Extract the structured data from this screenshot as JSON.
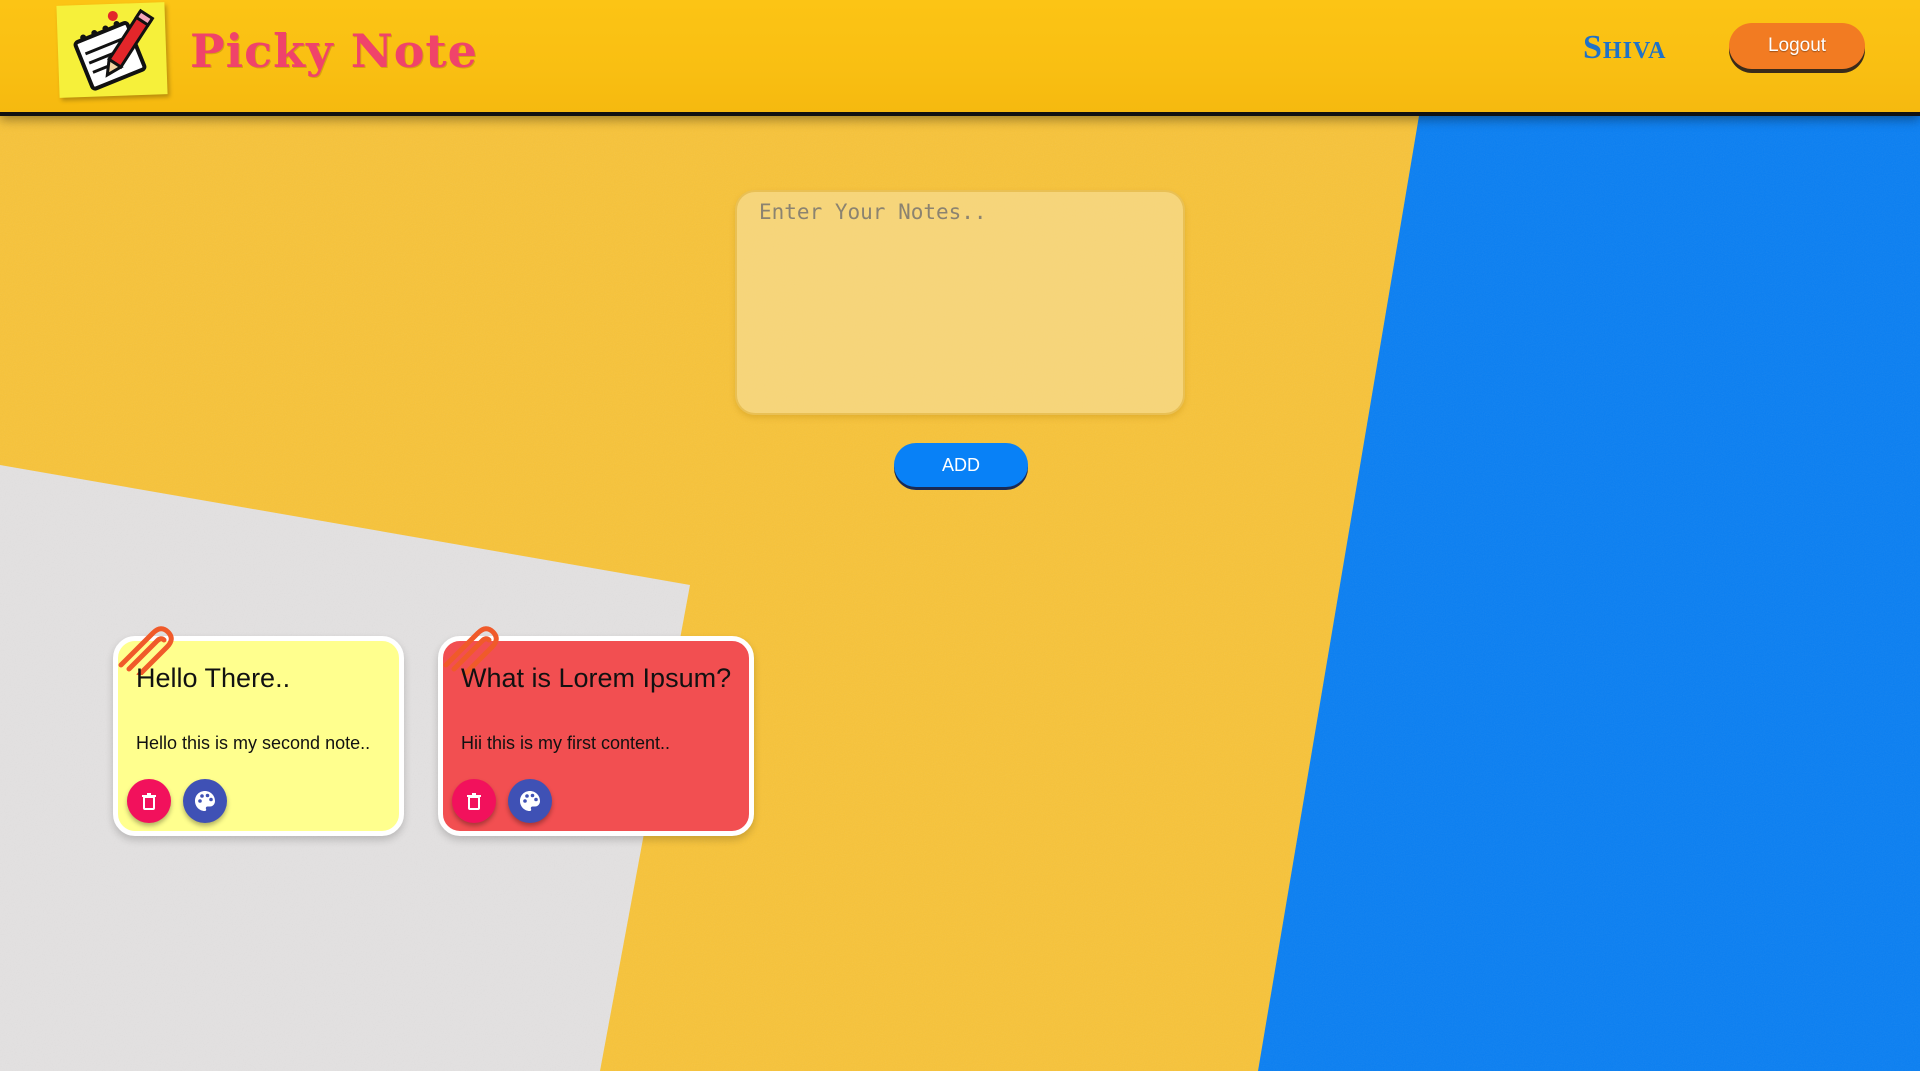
{
  "app": {
    "brand": "Picky Note",
    "username": "Shiva",
    "logout_label": "Logout"
  },
  "composer": {
    "placeholder": "Enter Your Notes..",
    "value": "",
    "add_label": "ADD"
  },
  "notes": [
    {
      "title": "Hello There..",
      "content": "Hello this is my second note..",
      "color": "#ffff8e",
      "actions": [
        "trash-icon",
        "palette-icon"
      ]
    },
    {
      "title": "What is Lorem Ipsum?",
      "content": "Hii this is my first content..",
      "color": "#f24f51",
      "actions": [
        "trash-icon",
        "palette-icon"
      ]
    }
  ],
  "theme": {
    "header": "#fcc415",
    "brand_text": "#f0436a",
    "username_text": "#1f72c8",
    "logout_button": "#f27b22",
    "add_button": "#0881f7",
    "delete_button": "#f2115c",
    "palette_button": "#3f51b5",
    "clip": "#f05a2a"
  }
}
